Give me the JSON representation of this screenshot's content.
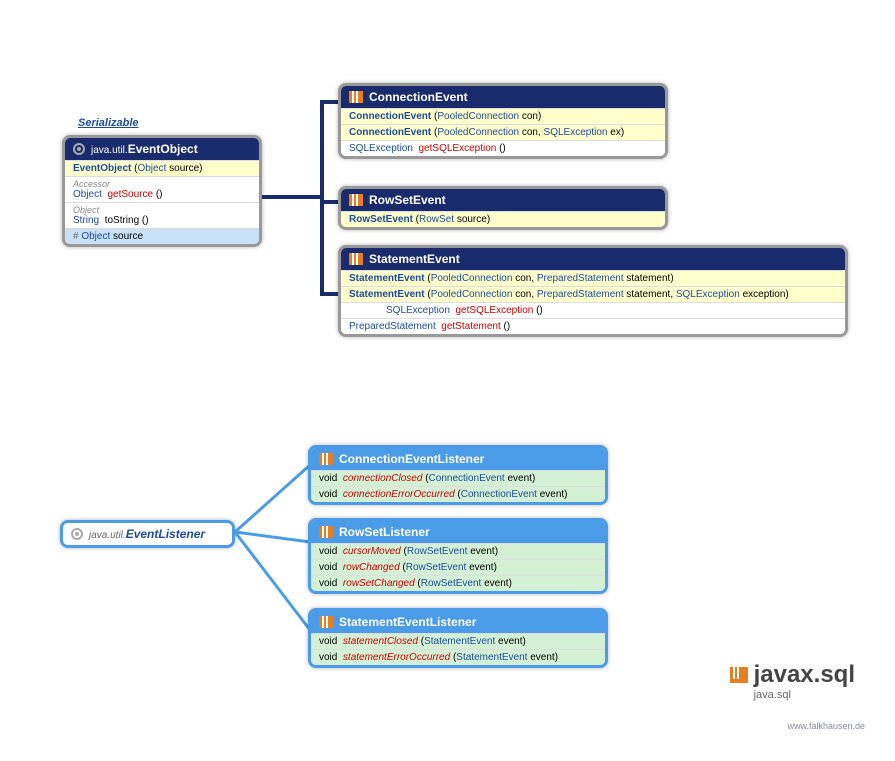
{
  "serializable_label": "Serializable",
  "eventObject": {
    "pkg": "java.util.",
    "name": "EventObject",
    "ctor_name": "EventObject",
    "ctor_param_type": "Object",
    "ctor_param_name": "source",
    "accessor_label": "Accessor",
    "getSource_ret": "Object",
    "getSource": "getSource",
    "object_label": "Object",
    "toString_ret": "String",
    "toString": "toString",
    "field_hash": "#",
    "field_type": "Object",
    "field_name": "source"
  },
  "connectionEvent": {
    "name": "ConnectionEvent",
    "ctor1": {
      "name": "ConnectionEvent",
      "p1t": "PooledConnection",
      "p1n": "con"
    },
    "ctor2": {
      "name": "ConnectionEvent",
      "p1t": "PooledConnection",
      "p1n": "con",
      "p2t": "SQLException",
      "p2n": "ex"
    },
    "m1": {
      "ret": "SQLException",
      "name": "getSQLException"
    }
  },
  "rowSetEvent": {
    "name": "RowSetEvent",
    "ctor": {
      "name": "RowSetEvent",
      "p1t": "RowSet",
      "p1n": "source"
    }
  },
  "statementEvent": {
    "name": "StatementEvent",
    "ctor1": {
      "name": "StatementEvent",
      "p1t": "PooledConnection",
      "p1n": "con",
      "p2t": "PreparedStatement",
      "p2n": "statement"
    },
    "ctor2": {
      "name": "StatementEvent",
      "p1t": "PooledConnection",
      "p1n": "con",
      "p2t": "PreparedStatement",
      "p2n": "statement",
      "p3t": "SQLException",
      "p3n": "exception"
    },
    "m1": {
      "ret": "SQLException",
      "name": "getSQLException"
    },
    "m2": {
      "ret": "PreparedStatement",
      "name": "getStatement"
    }
  },
  "eventListener": {
    "pkg": "java.util.",
    "name": "EventListener"
  },
  "connectionEventListener": {
    "name": "ConnectionEventListener",
    "m1": {
      "ret": "void",
      "name": "connectionClosed",
      "pt": "ConnectionEvent",
      "pn": "event"
    },
    "m2": {
      "ret": "void",
      "name": "connectionErrorOccurred",
      "pt": "ConnectionEvent",
      "pn": "event"
    }
  },
  "rowSetListener": {
    "name": "RowSetListener",
    "m1": {
      "ret": "void",
      "name": "cursorMoved",
      "pt": "RowSetEvent",
      "pn": "event"
    },
    "m2": {
      "ret": "void",
      "name": "rowChanged",
      "pt": "RowSetEvent",
      "pn": "event"
    },
    "m3": {
      "ret": "void",
      "name": "rowSetChanged",
      "pt": "RowSetEvent",
      "pn": "event"
    }
  },
  "statementEventListener": {
    "name": "StatementEventListener",
    "m1": {
      "ret": "void",
      "name": "statementClosed",
      "pt": "StatementEvent",
      "pn": "event"
    },
    "m2": {
      "ret": "void",
      "name": "statementErrorOccurred",
      "pt": "StatementEvent",
      "pn": "event"
    }
  },
  "package": {
    "big": "javax.sql",
    "sub": "java.sql"
  },
  "url": "www.falkhausen.de"
}
